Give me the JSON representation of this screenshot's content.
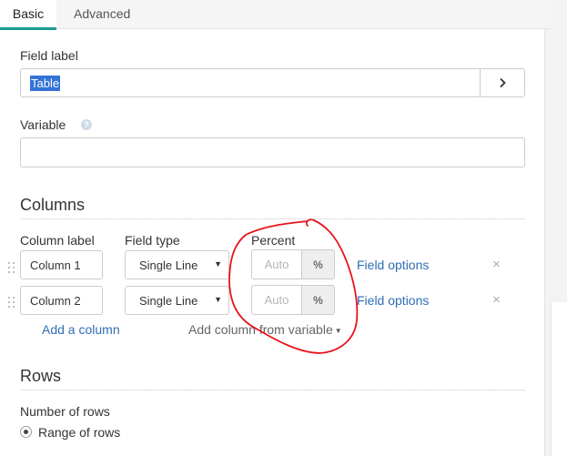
{
  "tabs": [
    {
      "label": "Basic",
      "active": true
    },
    {
      "label": "Advanced",
      "active": false
    }
  ],
  "field_label": {
    "label": "Field label",
    "value": "Table",
    "button_icon": "chevron-right-icon"
  },
  "variable": {
    "label": "Variable",
    "value": "",
    "help_icon": "question-circle-icon"
  },
  "columns": {
    "title": "Columns",
    "headers": {
      "label": "Column label",
      "type": "Field type",
      "percent": "Percent"
    },
    "rows": [
      {
        "label": "Column 1",
        "type": "Single Line",
        "percent_placeholder": "Auto",
        "percent_suffix": "%",
        "options_link": "Field options",
        "remove_icon": "×"
      },
      {
        "label": "Column 2",
        "type": "Single Line",
        "percent_placeholder": "Auto",
        "percent_suffix": "%",
        "options_link": "Field options",
        "remove_icon": "×"
      }
    ],
    "add_column": "Add a column",
    "add_from_variable": "Add column from variable"
  },
  "rows_section": {
    "title": "Rows",
    "number_of_rows_label": "Number of rows",
    "option_selected": "Range of rows"
  },
  "colors": {
    "accent_tab": "#1c9a94",
    "link": "#2f6db5",
    "selection": "#3273d6",
    "annotation": "#e8131b"
  }
}
